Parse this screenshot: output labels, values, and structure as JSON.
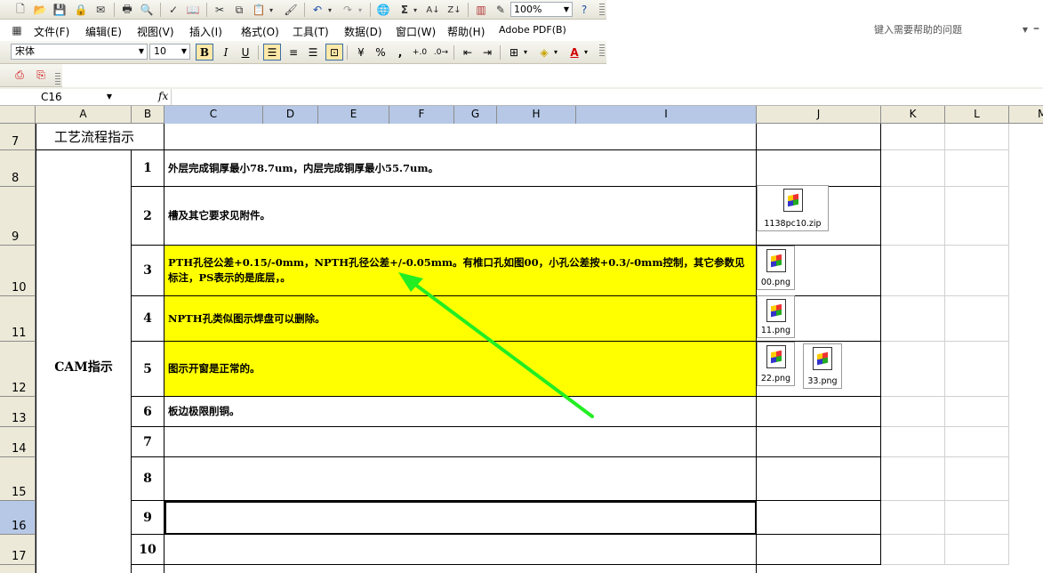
{
  "toolbar": {
    "zoom": "100%",
    "icons": [
      "new-icon",
      "open-icon",
      "save-icon",
      "permission-icon",
      "email-icon",
      "print-icon",
      "print-preview-icon",
      "spelling-icon",
      "research-icon",
      "cut-icon",
      "copy-icon",
      "paste-icon",
      "format-painter-icon",
      "undo-icon",
      "redo-icon",
      "hyperlink-icon",
      "autosum-icon",
      "sort-ascending-icon",
      "sort-descending-icon",
      "chart-wizard-icon",
      "drawing-icon",
      "help-icon"
    ]
  },
  "menu": {
    "items": [
      "文件(F)",
      "编辑(E)",
      "视图(V)",
      "插入(I)",
      "格式(O)",
      "工具(T)",
      "数据(D)",
      "窗口(W)",
      "帮助(H)",
      "Adobe PDF(B)"
    ],
    "help_placeholder": "键入需要帮助的问题"
  },
  "format": {
    "font": "宋体",
    "size": "10",
    "bold": "B",
    "italic": "I",
    "underline": "U",
    "percent": "%",
    "comma": ","
  },
  "formula_bar": {
    "name_box": "C16",
    "fx": "fx"
  },
  "columns": [
    "A",
    "B",
    "C",
    "D",
    "E",
    "F",
    "G",
    "H",
    "I",
    "J",
    "K",
    "L",
    "M"
  ],
  "rows": [
    "7",
    "8",
    "9",
    "10",
    "11",
    "12",
    "13",
    "14",
    "15",
    "16",
    "17"
  ],
  "sheet": {
    "title": "工艺流程指示",
    "section_label": "CAM指示",
    "items": [
      {
        "num": "1",
        "text": "外层完成铜厚最小78.7um，内层完成铜厚最小55.7um。"
      },
      {
        "num": "2",
        "text": "槽及其它要求见附件。"
      },
      {
        "num": "3",
        "text": "PTH孔径公差+0.15/-0mm，NPTH孔径公差+/-0.05mm。有椎口孔如图00，小孔公差按+0.3/-0mm控制，其它参数见标注，PS表示的是底层，。"
      },
      {
        "num": "4",
        "text": "NPTH孔类似图示焊盘可以删除。"
      },
      {
        "num": "5",
        "text": "图示开窗是正常的。"
      },
      {
        "num": "6",
        "text": "板边极限削铜。"
      },
      {
        "num": "7",
        "text": ""
      },
      {
        "num": "8",
        "text": ""
      },
      {
        "num": "9",
        "text": ""
      },
      {
        "num": "10",
        "text": ""
      }
    ],
    "attachments": [
      "1138pc10.zip",
      "00.png",
      "11.png",
      "22.png",
      "33.png"
    ],
    "highlight_color": "#ffff00",
    "arrow_color": "#22ee22"
  }
}
